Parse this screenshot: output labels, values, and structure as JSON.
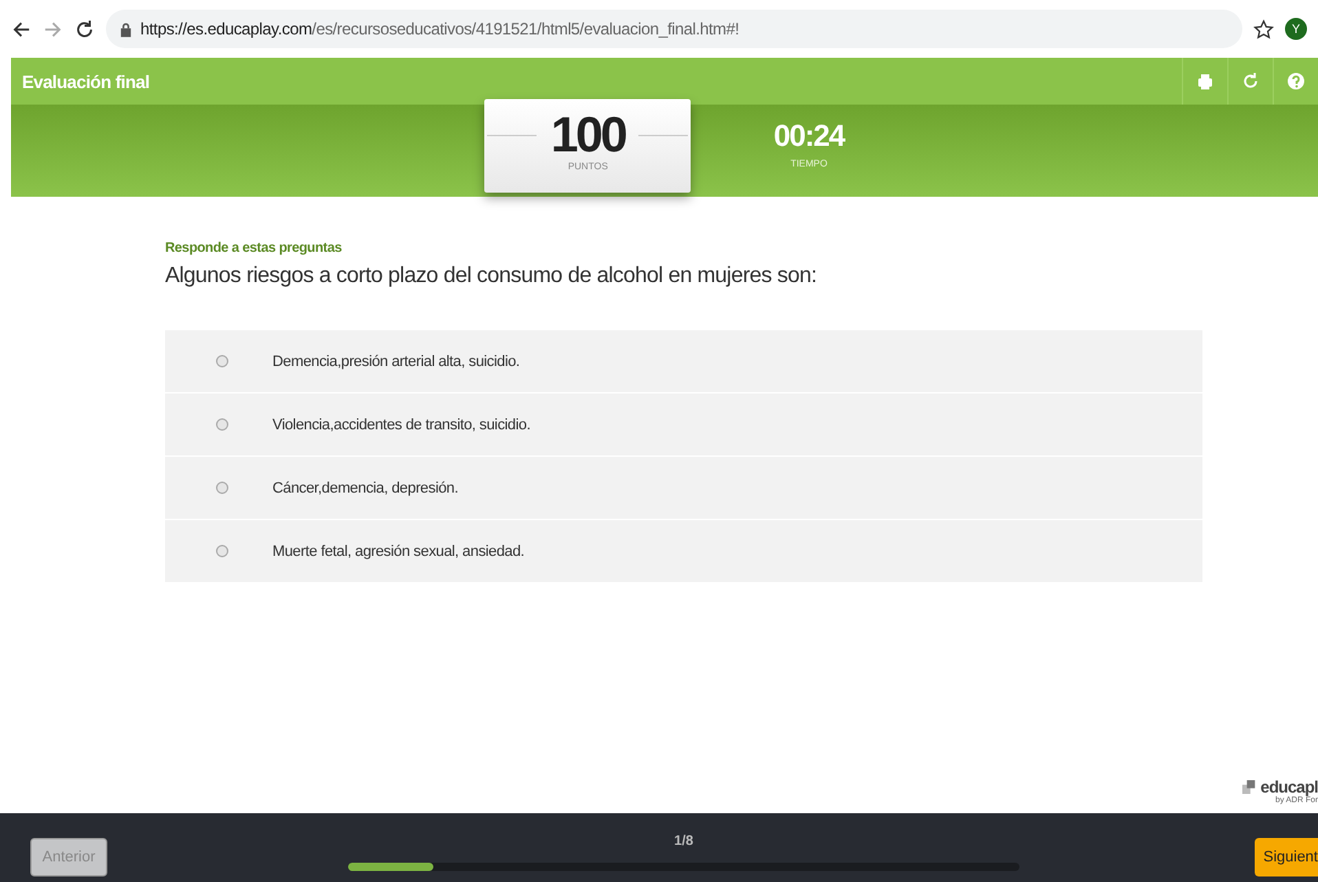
{
  "browser": {
    "url_host": "https://es.educaplay.com",
    "url_path": "/es/recursoseducativos/4191521/html5/evaluacion_final.htm#!",
    "avatar": "Y"
  },
  "header": {
    "title": "Evaluación final"
  },
  "score": {
    "value": "100",
    "label": "PUNTOS"
  },
  "timer": {
    "value": "00:24",
    "label": "TIEMPO"
  },
  "question": {
    "instruction": "Responde a estas preguntas",
    "text": "Algunos riesgos a corto plazo del consumo de alcohol en mujeres son:",
    "options": [
      {
        "label": "Demencia,presión arterial alta, suicidio.",
        "selected": false
      },
      {
        "label": "Violencia,accidentes de transito, suicidio.",
        "selected": false
      },
      {
        "label": "Cáncer,demencia, depresión.",
        "selected": false
      },
      {
        "label": "Muerte fetal, agresión sexual, ansiedad.",
        "selected": false
      }
    ]
  },
  "brand": {
    "name": "educapl",
    "byline": "by ADR For"
  },
  "footer": {
    "prev": "Anterior",
    "prev_disabled": true,
    "counter": "1/8",
    "level": 0.127,
    "next": "Siguient"
  }
}
